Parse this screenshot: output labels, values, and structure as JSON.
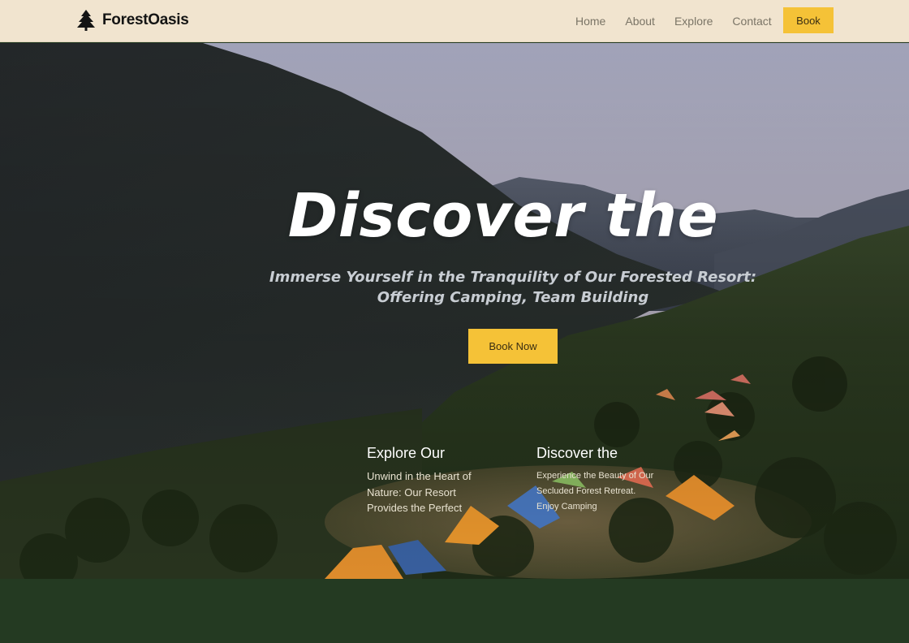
{
  "nav": {
    "brand": "ForestOasis",
    "brand_icon": "tree-icon",
    "links": [
      "Home",
      "About",
      "Explore",
      "Contact"
    ],
    "book_label": "Book"
  },
  "hero": {
    "title": "Discover the",
    "subtitle_line1": "Immerse Yourself in the Tranquility of Our Forested Resort:",
    "subtitle_line2": "Offering Camping, Team Building",
    "cta_label": "Book Now"
  },
  "features": [
    {
      "title": "Explore Our",
      "lines": [
        "Unwind in the Heart of",
        "Nature: Our Resort",
        "Provides the Perfect"
      ]
    },
    {
      "title": "Discover the",
      "lines": [
        "Experience the Beauty of Our",
        "Secluded Forest Retreat.",
        "Enjoy Camping"
      ]
    }
  ],
  "colors": {
    "nav_bg": "#f1e4cf",
    "accent": "#f5c237",
    "dark_green": "#243a22"
  }
}
